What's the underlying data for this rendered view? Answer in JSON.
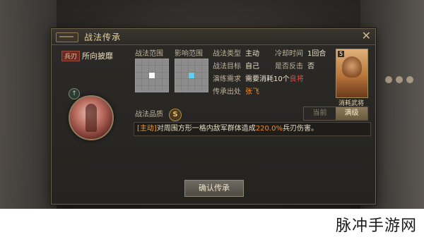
{
  "dialog": {
    "title": "战法传承",
    "close_glyph": "✕"
  },
  "tactic": {
    "type_tag": "兵刃",
    "name": "所向披靡"
  },
  "portrait_badge_glyph": "↑",
  "range": {
    "tactic_range_label": "战法范围",
    "effect_range_label": "影响范围"
  },
  "info": {
    "type_label": "战法类型",
    "type_value": "主动",
    "cooldown_label": "冷却时间",
    "cooldown_value": "1回合",
    "target_label": "战法目标",
    "target_value": "自己",
    "counter_label": "是否反击",
    "counter_value": "否",
    "require_label": "演练需求",
    "require_value": "需要消耗10个",
    "require_value_highlight": "良将",
    "source_label": "传承出处",
    "source_value": "张飞"
  },
  "card": {
    "star": "5",
    "caption": "消耗武将"
  },
  "quality": {
    "label": "战法品质",
    "value": "S"
  },
  "level_tabs": {
    "current": "当前",
    "max": "满级"
  },
  "description": {
    "prefix": "[主动]",
    "text_before": "对周围方形一格内敌军群体造成",
    "number": "220.0%",
    "text_after": "兵刃伤害。"
  },
  "confirm_label": "确认传承",
  "watermark": "脉冲手游网",
  "colors": {
    "accent_gold": "#e3cf9e",
    "highlight_orange": "#f08a2a",
    "highlight_red": "#e04a43",
    "effect_cell": "#5ad2ee"
  }
}
